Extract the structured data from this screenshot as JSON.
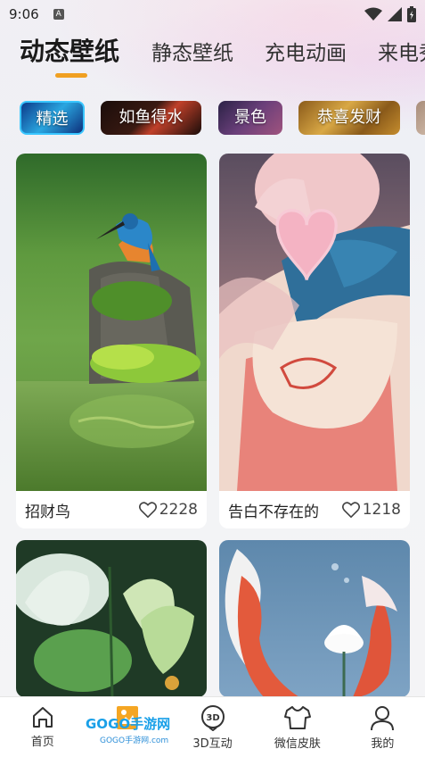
{
  "status": {
    "time": "9:06",
    "notif": "A"
  },
  "tabs": [
    {
      "label": "动态壁纸",
      "active": true
    },
    {
      "label": "静态壁纸",
      "active": false
    },
    {
      "label": "充电动画",
      "active": false
    },
    {
      "label": "来电秀",
      "active": false
    }
  ],
  "chips": [
    {
      "label": "精选"
    },
    {
      "label": "如鱼得水"
    },
    {
      "label": "景色"
    },
    {
      "label": "恭喜发财"
    }
  ],
  "cards": [
    {
      "title": "招财鸟",
      "likes": "2228"
    },
    {
      "title": "告白不存在的",
      "likes": "1218"
    },
    {
      "title": "",
      "likes": ""
    },
    {
      "title": "",
      "likes": ""
    }
  ],
  "nav": [
    {
      "label": "首页",
      "icon": "home-icon"
    },
    {
      "label": "",
      "icon": "wallpaper-icon"
    },
    {
      "label": "3D互动",
      "icon": "3d-icon"
    },
    {
      "label": "微信皮肤",
      "icon": "tshirt-icon"
    },
    {
      "label": "我的",
      "icon": "user-icon"
    }
  ],
  "watermark": {
    "text": "GOGO手游网",
    "sub": "GOGO手游网.com"
  },
  "colors": {
    "accent": "#f0a021",
    "watermark": "#1aa0e8"
  }
}
